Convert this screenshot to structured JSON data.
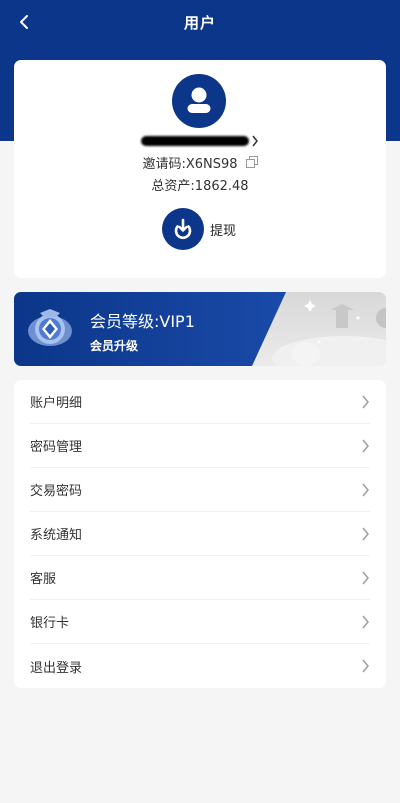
{
  "header": {
    "title": "用户",
    "back_icon": "chevron-left-icon"
  },
  "profile": {
    "avatar_icon": "user-avatar-icon",
    "username_arrow_icon": "chevron-right-icon",
    "invite_code": "邀请码:X6NS98",
    "copy_icon": "copy-icon",
    "total_assets": "总资产:1862.48",
    "withdraw_label": "提现",
    "withdraw_icon": "download-circle-icon"
  },
  "vip": {
    "level_text": "会员等级:VIP1",
    "upgrade_text": "会员升级",
    "badge_icon": "vip-badge-icon"
  },
  "menu": {
    "items": [
      {
        "label": "账户明细"
      },
      {
        "label": "密码管理"
      },
      {
        "label": "交易密码"
      },
      {
        "label": "系统通知"
      },
      {
        "label": "客服"
      },
      {
        "label": "银行卡"
      },
      {
        "label": "退出登录"
      }
    ],
    "arrow_icon": "chevron-right-icon"
  },
  "colors": {
    "brand": "#0b3689",
    "background": "#f5f5f5",
    "card": "#ffffff"
  }
}
